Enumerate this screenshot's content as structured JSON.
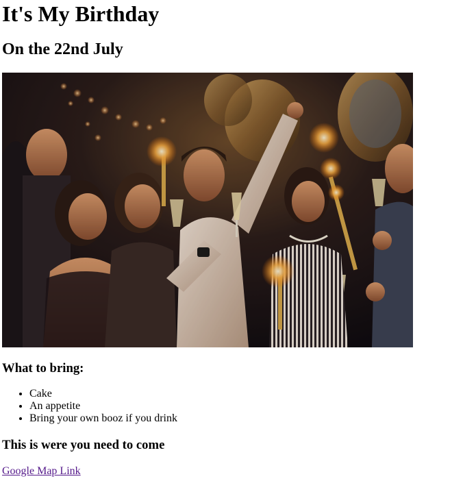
{
  "page": {
    "title": "It's My Birthday",
    "subtitle": "On the 22nd July"
  },
  "photo": {
    "alt": "party-photo"
  },
  "bring_section": {
    "heading": "What to bring:",
    "items": [
      "Cake",
      "An appetite",
      "Bring your own booz if you drink"
    ]
  },
  "location_section": {
    "heading": "This is were you need to come",
    "link_label": "Google Map Link"
  },
  "colors": {
    "visited_link": "#551a8b",
    "text": "#000000",
    "background": "#ffffff"
  }
}
